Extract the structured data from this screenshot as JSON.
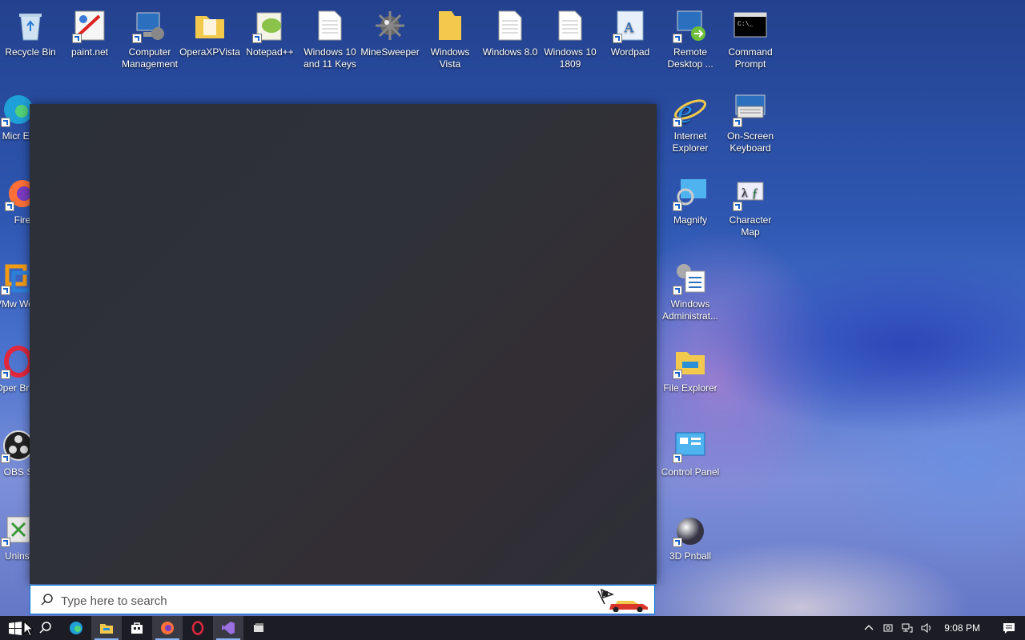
{
  "desktop": {
    "icons": [
      {
        "label": "Recycle Bin",
        "icon": "recycle-bin-icon"
      },
      {
        "label": "paint.net",
        "icon": "paint-net-icon"
      },
      {
        "label": "Computer Management",
        "icon": "computer-management-icon"
      },
      {
        "label": "OperaXPVista",
        "icon": "folder-icon"
      },
      {
        "label": "Notepad++",
        "icon": "notepad-plus-plus-icon"
      },
      {
        "label": "Windows 10 and 11 Keys",
        "icon": "text-file-icon"
      },
      {
        "label": "MineSweeper",
        "icon": "minesweeper-icon"
      },
      {
        "label": "Windows Vista",
        "icon": "folder-icon"
      },
      {
        "label": "Windows 8.0",
        "icon": "text-file-icon"
      },
      {
        "label": "Windows 10 1809",
        "icon": "text-file-icon"
      },
      {
        "label": "Wordpad",
        "icon": "wordpad-icon"
      },
      {
        "label": "Remote Desktop ...",
        "icon": "remote-desktop-icon"
      },
      {
        "label": "Command Prompt",
        "icon": "command-prompt-icon"
      },
      {
        "label": "Internet Explorer",
        "icon": "internet-explorer-icon"
      },
      {
        "label": "On-Screen Keyboard",
        "icon": "keyboard-icon"
      },
      {
        "label": "Magnify",
        "icon": "magnifier-icon"
      },
      {
        "label": "Character Map",
        "icon": "character-map-icon"
      },
      {
        "label": "Windows Administrat...",
        "icon": "admin-tools-icon"
      },
      {
        "label": "File Explorer",
        "icon": "file-explorer-icon"
      },
      {
        "label": "Control Panel",
        "icon": "control-panel-icon"
      },
      {
        "label": "3D Pnball",
        "icon": "pinball-icon"
      },
      {
        "label": "Micr Ed",
        "icon": "edge-icon"
      },
      {
        "label": "Fire",
        "icon": "firefox-icon"
      },
      {
        "label": "VMw Work",
        "icon": "vmware-icon"
      },
      {
        "label": "Oper Brow",
        "icon": "opera-icon"
      },
      {
        "label": "OBS S",
        "icon": "obs-icon"
      },
      {
        "label": "Uninst",
        "icon": "uninstaller-icon"
      }
    ]
  },
  "search": {
    "placeholder": "Type here to search"
  },
  "taskbar": {
    "buttons": [
      {
        "name": "start",
        "icon": "windows-logo-icon"
      },
      {
        "name": "search",
        "icon": "search-icon"
      },
      {
        "name": "edge",
        "icon": "edge-icon"
      },
      {
        "name": "file-explorer",
        "icon": "file-explorer-icon"
      },
      {
        "name": "store",
        "icon": "store-icon"
      },
      {
        "name": "firefox",
        "icon": "firefox-icon"
      },
      {
        "name": "opera",
        "icon": "opera-icon"
      },
      {
        "name": "visual-studio",
        "icon": "visual-studio-icon"
      },
      {
        "name": "app",
        "icon": "app-icon"
      }
    ],
    "clock": "9:08 PM"
  },
  "colors": {
    "accent": "#0078d7",
    "taskbar": "#1c1c24",
    "panel": "#2e3037"
  }
}
